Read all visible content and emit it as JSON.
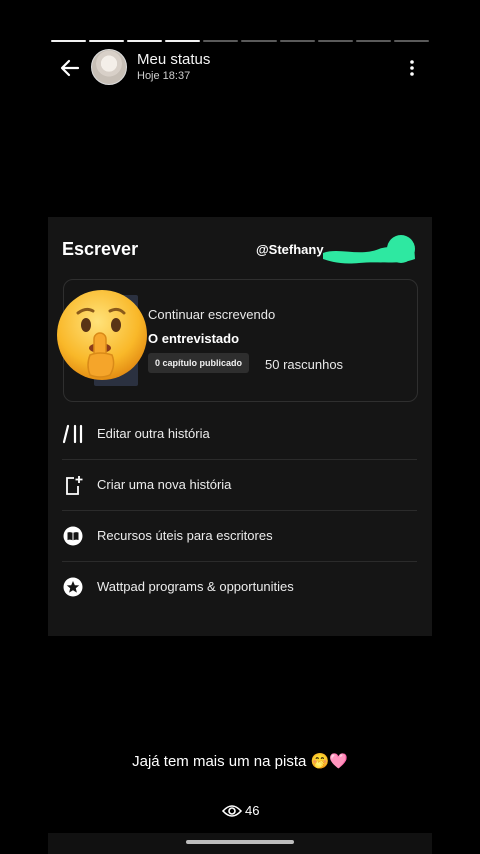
{
  "status": {
    "title": "Meu status",
    "time": "Hoje 18:37",
    "progress_segments": 10,
    "progress_done": 4
  },
  "card": {
    "title": "Escrever",
    "username": "@Stefhany",
    "continue_label": "Continuar escrevendo",
    "story_title": "O entrevistado",
    "chip": "0 capítulo publicado",
    "drafts": "50 rascunhos",
    "menu": [
      {
        "label": "Editar outra história",
        "icon": "edit-story-icon"
      },
      {
        "label": "Criar uma nova história",
        "icon": "new-story-icon"
      },
      {
        "label": "Recursos úteis para escritores",
        "icon": "book-icon"
      },
      {
        "label": "Wattpad programs & opportunities",
        "icon": "star-icon"
      }
    ]
  },
  "caption": "Jajá tem mais um na pista 🤭🩷",
  "views": "46",
  "colors": {
    "scribble": "#2ee8a1",
    "background": "#000000",
    "card": "#151515"
  }
}
